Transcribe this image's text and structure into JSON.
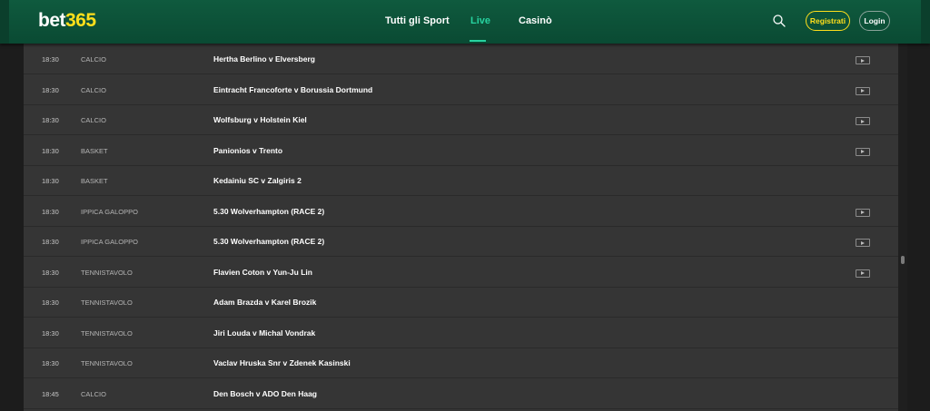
{
  "header": {
    "logo_main": "bet",
    "logo_accent": "365",
    "nav": [
      {
        "label": "Tutti gli Sport"
      },
      {
        "label": "Live"
      },
      {
        "label": "Casinò"
      }
    ],
    "register_label": "Registrati",
    "login_label": "Login"
  },
  "colors": {
    "header_bg": "#0f5a3e",
    "accent_yellow": "#ffdf1b",
    "active_green": "#27d3a0",
    "row_bg": "#353535"
  },
  "events": [
    {
      "time": "18:30",
      "sport": "CALCIO",
      "name": "Hertha Berlino v Elversberg",
      "stream": true
    },
    {
      "time": "18:30",
      "sport": "CALCIO",
      "name": "Eintracht Francoforte v Borussia Dortmund",
      "stream": true
    },
    {
      "time": "18:30",
      "sport": "CALCIO",
      "name": "Wolfsburg v Holstein Kiel",
      "stream": true
    },
    {
      "time": "18:30",
      "sport": "BASKET",
      "name": "Panionios v Trento",
      "stream": true
    },
    {
      "time": "18:30",
      "sport": "BASKET",
      "name": "Kedainiu SC v Zalgiris 2",
      "stream": false
    },
    {
      "time": "18:30",
      "sport": "IPPICA GALOPPO",
      "name": "5.30 Wolverhampton (RACE 2)",
      "stream": true
    },
    {
      "time": "18:30",
      "sport": "IPPICA GALOPPO",
      "name": "5.30 Wolverhampton (RACE 2)",
      "stream": true
    },
    {
      "time": "18:30",
      "sport": "TENNISTAVOLO",
      "name": "Flavien Coton v Yun-Ju Lin",
      "stream": true
    },
    {
      "time": "18:30",
      "sport": "TENNISTAVOLO",
      "name": "Adam Brazda v Karel Brozik",
      "stream": false
    },
    {
      "time": "18:30",
      "sport": "TENNISTAVOLO",
      "name": "Jiri Louda v Michal Vondrak",
      "stream": false
    },
    {
      "time": "18:30",
      "sport": "TENNISTAVOLO",
      "name": "Vaclav Hruska Snr v Zdenek Kasinski",
      "stream": false
    },
    {
      "time": "18:45",
      "sport": "CALCIO",
      "name": "Den Bosch v ADO Den Haag",
      "stream": false
    }
  ]
}
